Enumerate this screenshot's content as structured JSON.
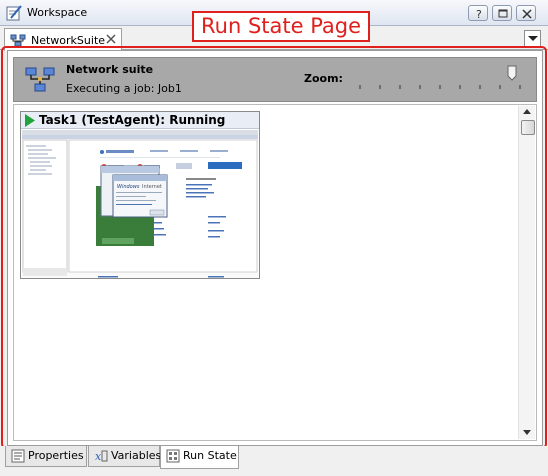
{
  "window": {
    "title": "Workspace"
  },
  "document_tab": {
    "label": "NetworkSuite"
  },
  "run_state": {
    "suite_name": "Network suite",
    "suite_status": "Executing a job: Job1",
    "zoom_label": "Zoom:",
    "task": {
      "title": "Task1 (TestAgent): Running"
    }
  },
  "annotation": {
    "label": "Run State Page",
    "color": "#e0201c"
  },
  "bottom_tabs": [
    {
      "label": "Properties"
    },
    {
      "label": "Variables"
    },
    {
      "label": "Run State",
      "active": true
    }
  ]
}
